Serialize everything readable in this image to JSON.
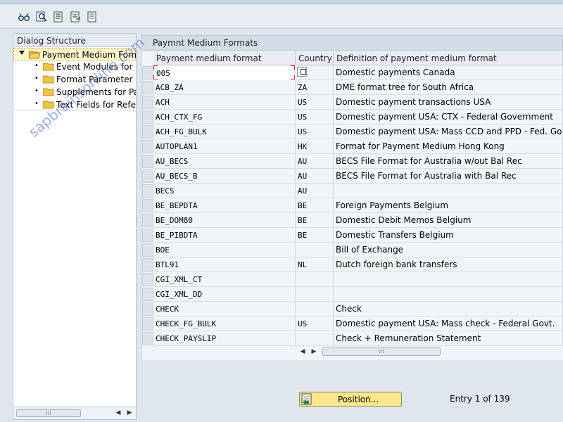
{
  "left_panel": {
    "header": "Dialog Structure",
    "root": {
      "label": "Payment Medium Formats",
      "expanded": true
    },
    "children": [
      {
        "label": "Event Modules for Payment Medium Formats"
      },
      {
        "label": "Format Parameter Reference"
      },
      {
        "label": "Supplements for Payment Medium Formats"
      },
      {
        "label": "Text Fields for Reference Fields"
      }
    ]
  },
  "table": {
    "title": "Paymnt Medium Formats",
    "columns": [
      "Payment medium format",
      "Country",
      "Definition of payment medium format"
    ],
    "rows": [
      {
        "format": "005",
        "country": "",
        "definition": "Domestic payments Canada"
      },
      {
        "format": "ACB_ZA",
        "country": "ZA",
        "definition": "DME format tree for South Africa"
      },
      {
        "format": "ACH",
        "country": "US",
        "definition": "Domestic payment transactions USA"
      },
      {
        "format": "ACH_CTX_FG",
        "country": "US",
        "definition": "Domestic payment USA: CTX - Federal Government"
      },
      {
        "format": "ACH_FG_BULK",
        "country": "US",
        "definition": "Domestic payment USA: Mass CCD and PPD - Fed. Govt"
      },
      {
        "format": "AUTOPLAN1",
        "country": "HK",
        "definition": "Format for Payment Medium Hong Kong"
      },
      {
        "format": "AU_BECS",
        "country": "AU",
        "definition": "BECS File Format for Australia w/out Bal Rec"
      },
      {
        "format": "AU_BECS_B",
        "country": "AU",
        "definition": "BECS File Format for Australia with Bal Rec"
      },
      {
        "format": "BECS",
        "country": "AU",
        "definition": ""
      },
      {
        "format": "BE_BEPDTA",
        "country": "BE",
        "definition": "Foreign Payments Belgium"
      },
      {
        "format": "BE_DOM80",
        "country": "BE",
        "definition": "Domestic Debit Memos Belgium"
      },
      {
        "format": "BE_PIBDTA",
        "country": "BE",
        "definition": "Domestic Transfers Belgium"
      },
      {
        "format": "BOE",
        "country": "",
        "definition": "Bill of Exchange"
      },
      {
        "format": "BTL91",
        "country": "NL",
        "definition": "Dutch foreign bank transfers"
      },
      {
        "format": "CGI_XML_CT",
        "country": "",
        "definition": ""
      },
      {
        "format": "CGI_XML_DD",
        "country": "",
        "definition": ""
      },
      {
        "format": "CHECK",
        "country": "",
        "definition": "Check"
      },
      {
        "format": "CHECK_FG_BULK",
        "country": "US",
        "definition": "Domestic payment USA: Mass check - Federal Govt."
      },
      {
        "format": "CHECK_PAYSLIP",
        "country": "",
        "definition": "Check + Remuneration Statement"
      }
    ]
  },
  "footer": {
    "position_button": "Position...",
    "entry_text": "Entry 1 of 139"
  },
  "watermark": "sapbrainsonline.com",
  "toolbar": {
    "icons": [
      "glasses-icon",
      "find-icon",
      "select-all-icon",
      "select-block-icon",
      "deselect-all-icon"
    ]
  }
}
